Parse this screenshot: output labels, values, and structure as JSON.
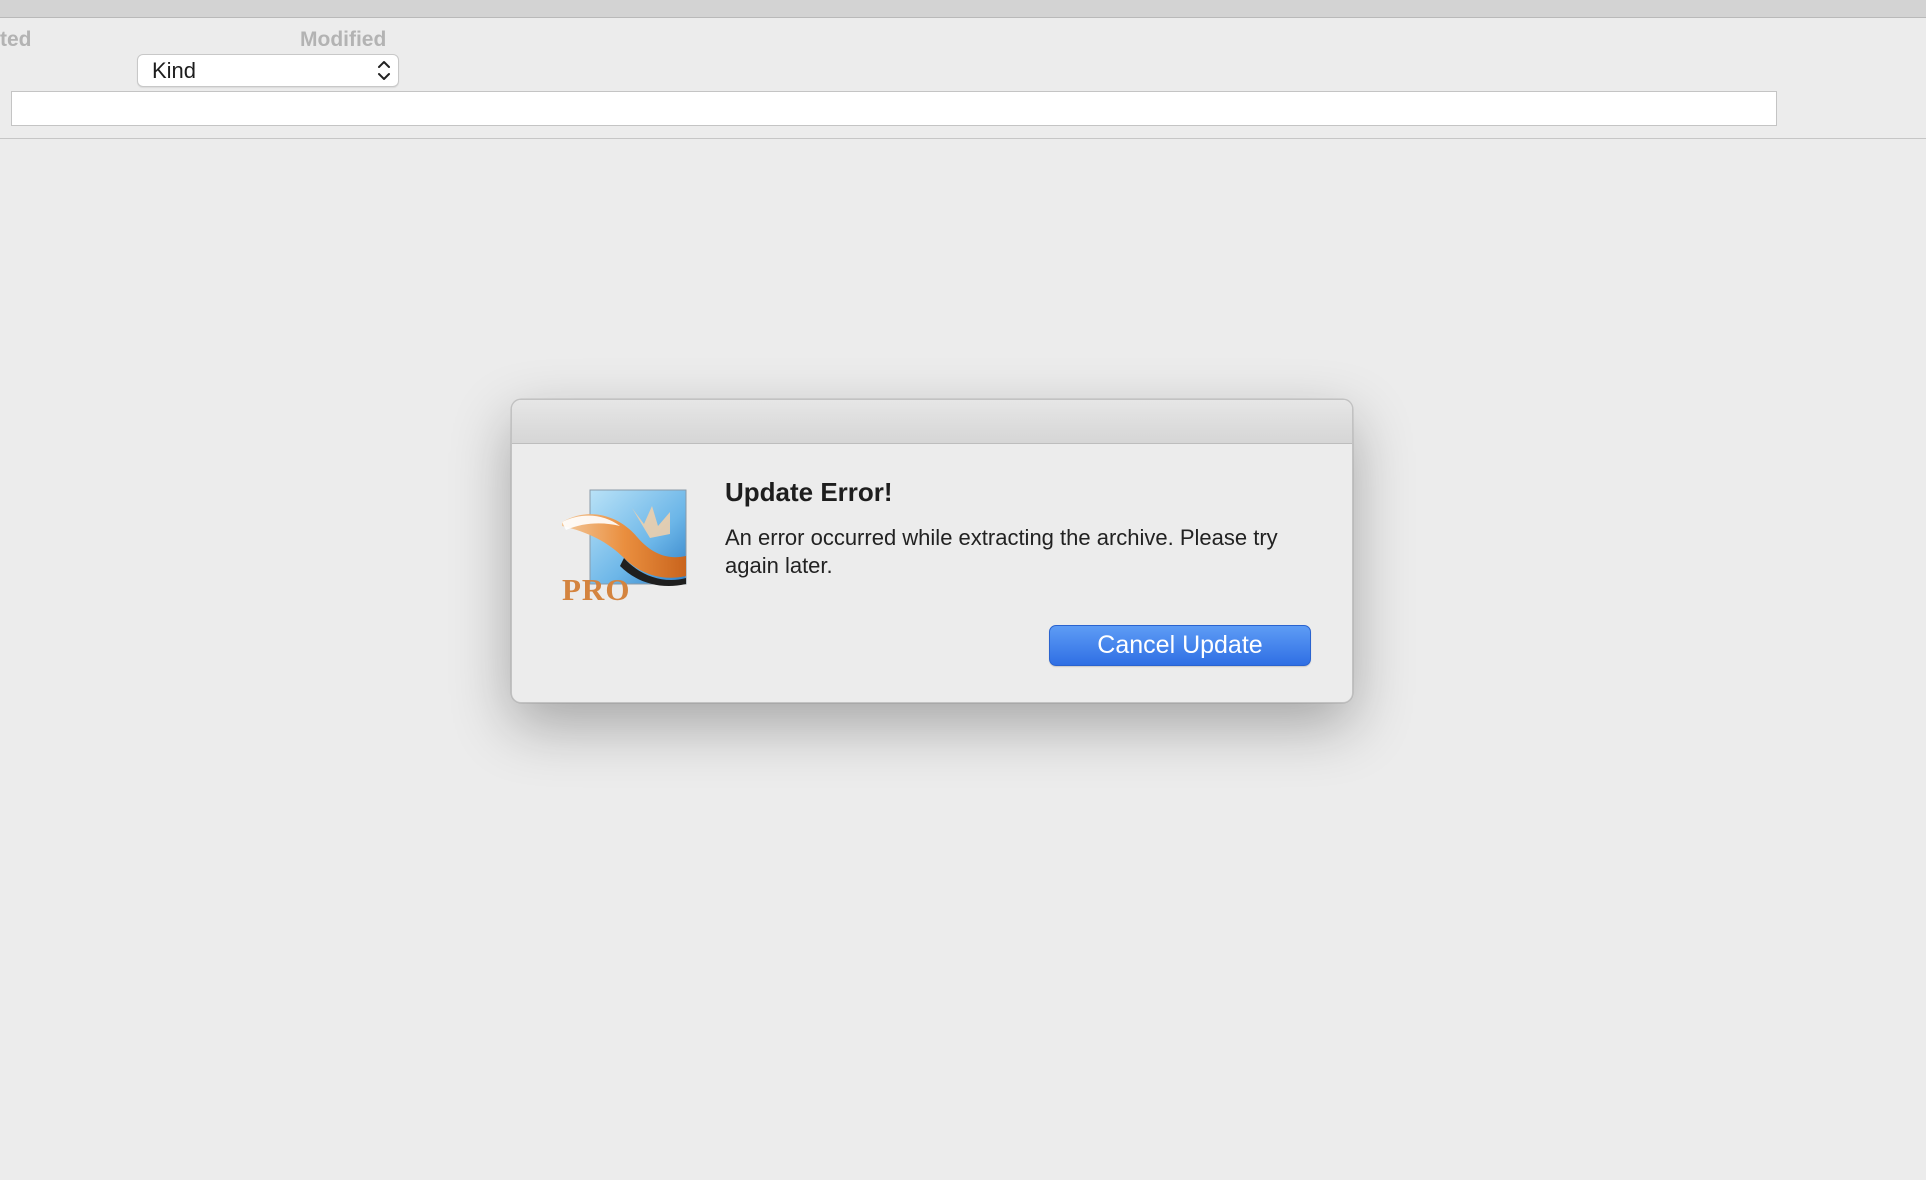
{
  "columns": {
    "created_label": "ted",
    "modified_label": "Modified"
  },
  "kind_select": {
    "value": "Kind"
  },
  "search_field": {
    "value": ""
  },
  "dialog": {
    "title": "Update Error!",
    "message": "An error occurred while extracting the archive. Please try again later.",
    "icon": "app-pro-icon",
    "icon_badge": "PRO",
    "button_label": "Cancel Update",
    "button_color": "#3b7ef0"
  }
}
